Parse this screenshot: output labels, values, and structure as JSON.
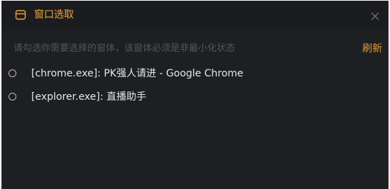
{
  "dialog": {
    "title": "窗口选取",
    "hint": "请勾选你需要选择的窗体，该窗体必须是非最小化状态",
    "refresh_label": "刷新",
    "title_icon": "window-icon",
    "close_icon": "close-icon"
  },
  "windows": [
    {
      "label": "[chrome.exe]: PK强人请进 - Google Chrome",
      "selected": false
    },
    {
      "label": "[explorer.exe]: 直播助手",
      "selected": false
    }
  ],
  "colors": {
    "accent": "#f0a73a",
    "background": "#1e1f23",
    "hint": "#54565c",
    "text": "#e6e7ea"
  }
}
